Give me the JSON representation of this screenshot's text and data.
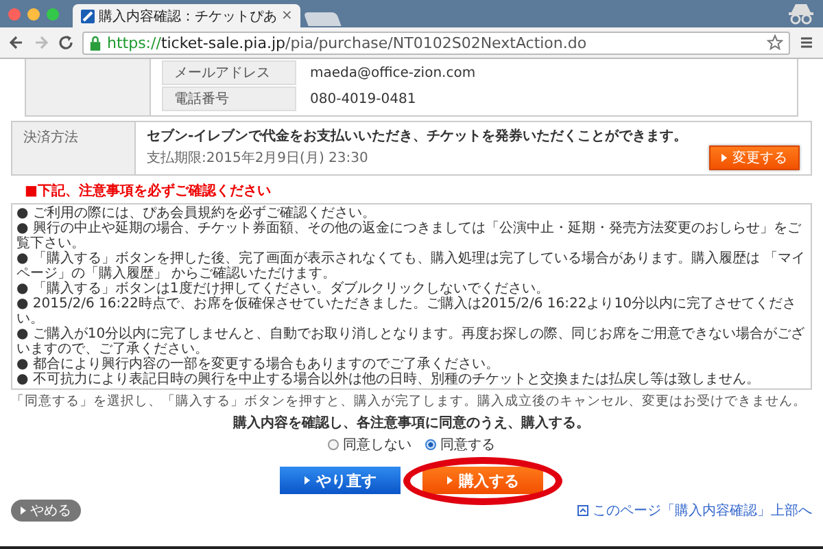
{
  "browser": {
    "tab_title": "購入内容確認：チケットぴあ",
    "tab_close": "×",
    "url_scheme": "https://",
    "url_host": "ticket-sale.pia.jp",
    "url_path": "/pia/purchase/NT0102S02NextAction.do"
  },
  "contact_rows": [
    {
      "label": "メールアドレス",
      "value": "maeda@office-zion.com"
    },
    {
      "label": "電話番号",
      "value": "080-4019-0481"
    }
  ],
  "payment": {
    "label": "決済方法",
    "description": "セブン-イレブンで代金をお支払いいただき、チケットを発券いただくことができます。",
    "deadline": "支払期限:2015年2月9日(月) 23:30",
    "change_button": "変更する"
  },
  "notice_heading": "■下記、注意事項を必ずご確認ください",
  "notices": [
    "● ご利用の際には、ぴあ会員規約を必ずご確認ください。",
    "● 興行の中止や延期の場合、チケット券面額、その他の返金につきましては「公演中止・延期・発売方法変更のおしらせ」をご覧下さい。",
    "● 「購入する」ボタンを押した後、完了画面が表示されなくても、購入処理は完了している場合があります。購入履歴は 「マイページ」の「購入履歴」 からご確認いただけます。",
    "● 「購入する」ボタンは1度だけ押してください。ダブルクリックしないでください。",
    "● 2015/2/6 16:22時点で、お席を仮確保させていただきました。ご購入は2015/2/6 16:22より10分以内に完了させてください。",
    "● ご購入が10分以内に完了しませんと、自動でお取り消しとなります。再度お探しの際、同じお席をご用意できない場合がございますので、ご了承ください。",
    "● 都合により興行内容の一部を変更する場合もありますのでご了承ください。",
    "● 不可抗力により表記日時の興行を中止する場合以外は他の日時、別種のチケットと交換または払戻し等は致しません。"
  ],
  "agreement_note": "「同意する」を選択し、「購入する」ボタンを押すと、購入が完了します。購入成立後のキャンセル、変更はお受けできません。",
  "agreement_heading": "購入内容を確認し、各注意事項に同意のうえ、購入する。",
  "agreement_options": [
    {
      "label": "同意しない",
      "selected": false
    },
    {
      "label": "同意する",
      "selected": true
    }
  ],
  "action_buttons": [
    {
      "kind": "secondary",
      "label": "やり直す"
    },
    {
      "kind": "primary",
      "label": "購入する",
      "highlighted": true
    }
  ],
  "cancel_button": "やめる",
  "page_top_link": "このページ「購入内容確認」上部へ"
}
